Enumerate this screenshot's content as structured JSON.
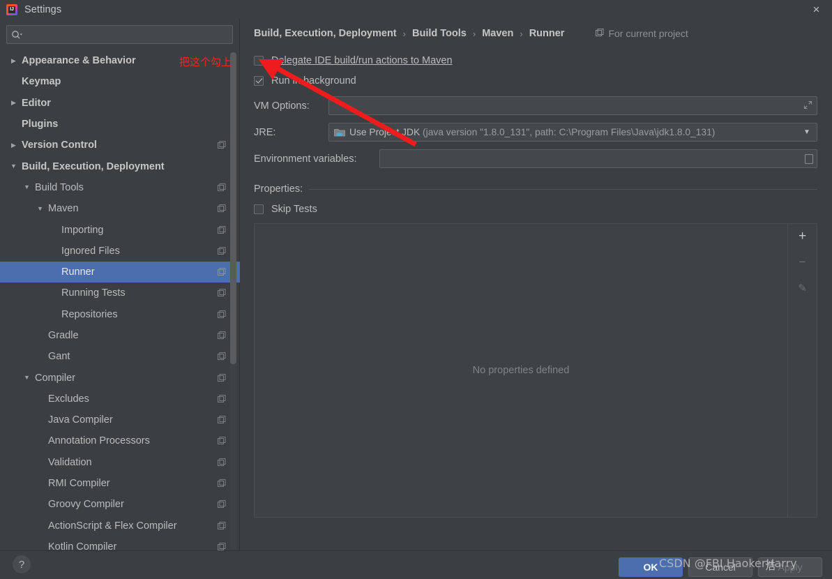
{
  "window": {
    "title": "Settings",
    "app_icon": "intellij-idea-icon",
    "close_label": "×"
  },
  "sidebar": {
    "search": {
      "placeholder": "",
      "value": "",
      "icon": "search-icon"
    },
    "items": [
      {
        "label": "Appearance & Behavior",
        "indent": 0,
        "arrow": "▶",
        "bold": true,
        "scope": false,
        "selected": false
      },
      {
        "label": "Keymap",
        "indent": 0,
        "arrow": "",
        "bold": true,
        "scope": false,
        "selected": false
      },
      {
        "label": "Editor",
        "indent": 0,
        "arrow": "▶",
        "bold": true,
        "scope": false,
        "selected": false
      },
      {
        "label": "Plugins",
        "indent": 0,
        "arrow": "",
        "bold": true,
        "scope": false,
        "selected": false
      },
      {
        "label": "Version Control",
        "indent": 0,
        "arrow": "▶",
        "bold": true,
        "scope": true,
        "selected": false
      },
      {
        "label": "Build, Execution, Deployment",
        "indent": 0,
        "arrow": "▼",
        "bold": true,
        "scope": false,
        "selected": false
      },
      {
        "label": "Build Tools",
        "indent": 1,
        "arrow": "▼",
        "bold": false,
        "scope": true,
        "selected": false
      },
      {
        "label": "Maven",
        "indent": 2,
        "arrow": "▼",
        "bold": false,
        "scope": true,
        "selected": false
      },
      {
        "label": "Importing",
        "indent": 3,
        "arrow": "",
        "bold": false,
        "scope": true,
        "selected": false
      },
      {
        "label": "Ignored Files",
        "indent": 3,
        "arrow": "",
        "bold": false,
        "scope": true,
        "selected": false
      },
      {
        "label": "Runner",
        "indent": 3,
        "arrow": "",
        "bold": false,
        "scope": true,
        "selected": true
      },
      {
        "label": "Running Tests",
        "indent": 3,
        "arrow": "",
        "bold": false,
        "scope": true,
        "selected": false
      },
      {
        "label": "Repositories",
        "indent": 3,
        "arrow": "",
        "bold": false,
        "scope": true,
        "selected": false
      },
      {
        "label": "Gradle",
        "indent": 2,
        "arrow": "",
        "bold": false,
        "scope": true,
        "selected": false
      },
      {
        "label": "Gant",
        "indent": 2,
        "arrow": "",
        "bold": false,
        "scope": true,
        "selected": false
      },
      {
        "label": "Compiler",
        "indent": 1,
        "arrow": "▼",
        "bold": false,
        "scope": true,
        "selected": false
      },
      {
        "label": "Excludes",
        "indent": 2,
        "arrow": "",
        "bold": false,
        "scope": true,
        "selected": false
      },
      {
        "label": "Java Compiler",
        "indent": 2,
        "arrow": "",
        "bold": false,
        "scope": true,
        "selected": false
      },
      {
        "label": "Annotation Processors",
        "indent": 2,
        "arrow": "",
        "bold": false,
        "scope": true,
        "selected": false
      },
      {
        "label": "Validation",
        "indent": 2,
        "arrow": "",
        "bold": false,
        "scope": true,
        "selected": false
      },
      {
        "label": "RMI Compiler",
        "indent": 2,
        "arrow": "",
        "bold": false,
        "scope": true,
        "selected": false
      },
      {
        "label": "Groovy Compiler",
        "indent": 2,
        "arrow": "",
        "bold": false,
        "scope": true,
        "selected": false
      },
      {
        "label": "ActionScript & Flex Compiler",
        "indent": 2,
        "arrow": "",
        "bold": false,
        "scope": true,
        "selected": false
      },
      {
        "label": "Kotlin Compiler",
        "indent": 2,
        "arrow": "",
        "bold": false,
        "scope": true,
        "selected": false
      }
    ]
  },
  "breadcrumb": {
    "crumbs": [
      "Build, Execution, Deployment",
      "Build Tools",
      "Maven",
      "Runner"
    ],
    "separator": "›",
    "scope_note": "For current project",
    "scope_icon": "project-scope-icon"
  },
  "main": {
    "delegate_checkbox": {
      "label": "Delegate IDE build/run actions to Maven",
      "checked": false,
      "mnemonic": "D"
    },
    "background_checkbox": {
      "label": "Run in background",
      "checked": true
    },
    "vm_options": {
      "label": "VM Options:",
      "value": "",
      "expand_icon": "expand-icon"
    },
    "jre": {
      "label": "JRE:",
      "value": "Use Project JDK",
      "detail": " (java version \"1.8.0_131\", path: C:\\Program Files\\Java\\jdk1.8.0_131)",
      "icon": "folder-jdk-icon",
      "arrow": "▼"
    },
    "env_vars": {
      "label": "Environment variables:",
      "value": "",
      "browse_icon": "browse-icon"
    },
    "properties_section": {
      "title": "Properties:"
    },
    "skip_tests": {
      "label": "Skip Tests",
      "checked": false,
      "mnemonic": "T"
    },
    "properties_empty_text": "No properties defined",
    "properties_toolbar": [
      {
        "name": "add-property-button",
        "glyph": "+",
        "enabled": true
      },
      {
        "name": "remove-property-button",
        "glyph": "−",
        "enabled": false
      },
      {
        "name": "edit-property-button",
        "glyph": "✎",
        "enabled": false
      }
    ]
  },
  "footer": {
    "help_glyph": "?",
    "buttons": [
      {
        "label": "OK",
        "style": "primary"
      },
      {
        "label": "Cancel",
        "style": "normal"
      },
      {
        "label": "Apply",
        "style": "disabled"
      }
    ]
  },
  "annotations": {
    "note_text": "把这个勾上",
    "note_color": "#e52b2b",
    "arrow_color": "#ee1c1c",
    "watermark": "CSDN @FBI HaokerHarry",
    "watermark_overlay": "浩"
  }
}
